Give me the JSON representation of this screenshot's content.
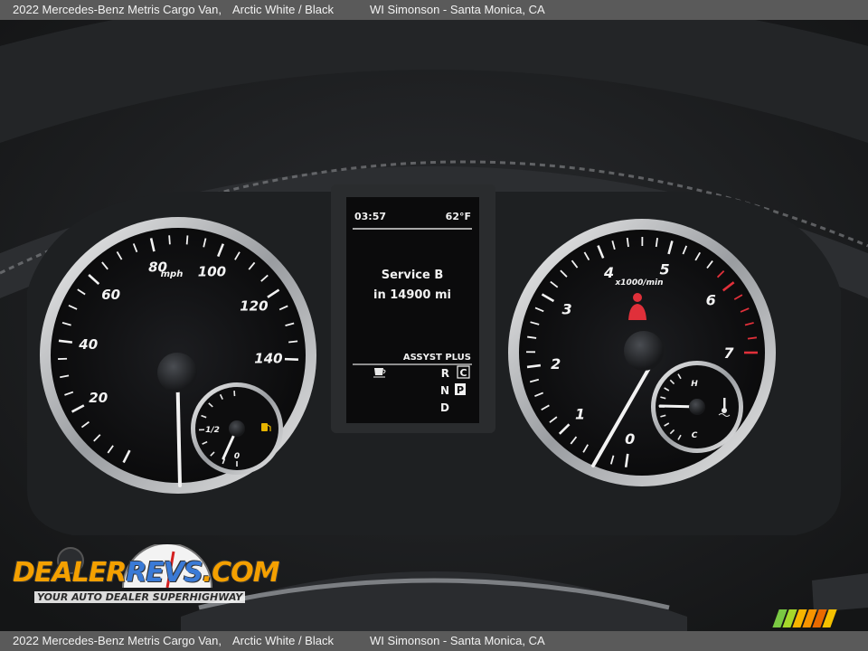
{
  "caption": {
    "vehicle": "2022 Mercedes-Benz Metris Cargo Van,",
    "color": "Arctic White / Black",
    "dealer": "WI Simonson - Santa Monica, CA"
  },
  "speedometer": {
    "unit": "mph",
    "labels": [
      "20",
      "40",
      "60",
      "80",
      "100",
      "120",
      "140"
    ],
    "fuel_half_label": "1/2",
    "fuel_empty_label": "0"
  },
  "tachometer": {
    "unit": "x1000/min",
    "labels": [
      "0",
      "1",
      "2",
      "3",
      "4",
      "5",
      "6",
      "7"
    ],
    "temp_hot_label": "H",
    "temp_cold_label": "C"
  },
  "display": {
    "time": "03:57",
    "temperature": "62°F",
    "service_line1": "Service B",
    "service_line2": "in 14900 mi",
    "assyst": "ASSYST PLUS",
    "gear_r": "R",
    "gear_c": "C",
    "gear_n": "N",
    "gear_p": "P",
    "gear_d": "D"
  },
  "watermark": {
    "logo_part1": "DEALER",
    "logo_part2": "REVS",
    "logo_part3": ".COM",
    "tagline": "YOUR AUTO DEALER SUPERHIGHWAY"
  },
  "colors": {
    "caption_bg": "#5a5a5a",
    "redline": "#e0303a",
    "stripes": [
      "#7ac943",
      "#a6d82b",
      "#f7b500",
      "#f79400",
      "#e86a00",
      "#f4c000"
    ]
  }
}
